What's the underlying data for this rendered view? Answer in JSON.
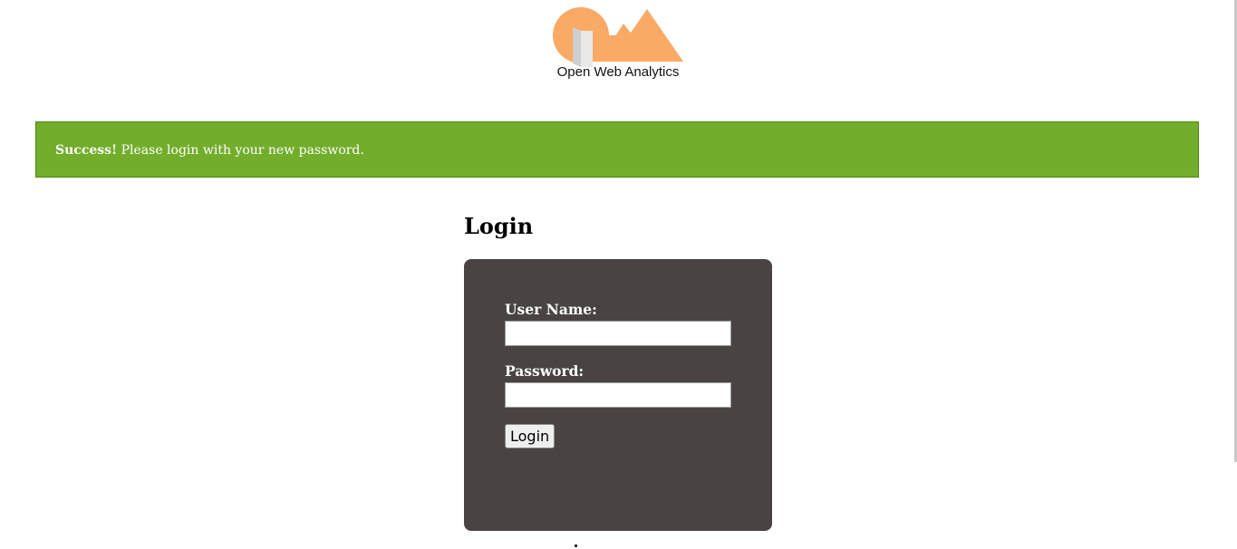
{
  "logo": {
    "text": "Open Web Analytics",
    "colors": {
      "primary": "#fbaa66",
      "door_front": "#e6e6e6",
      "door_side": "#cfcfcf"
    }
  },
  "banner": {
    "strong": "Success!",
    "message": " Please login with your new password.",
    "color": "#72ad2b"
  },
  "login": {
    "heading": "Login",
    "username_label": "User Name:",
    "username_value": "",
    "password_label": "Password:",
    "password_value": "",
    "button_label": "Login",
    "panel_color": "#494443"
  }
}
